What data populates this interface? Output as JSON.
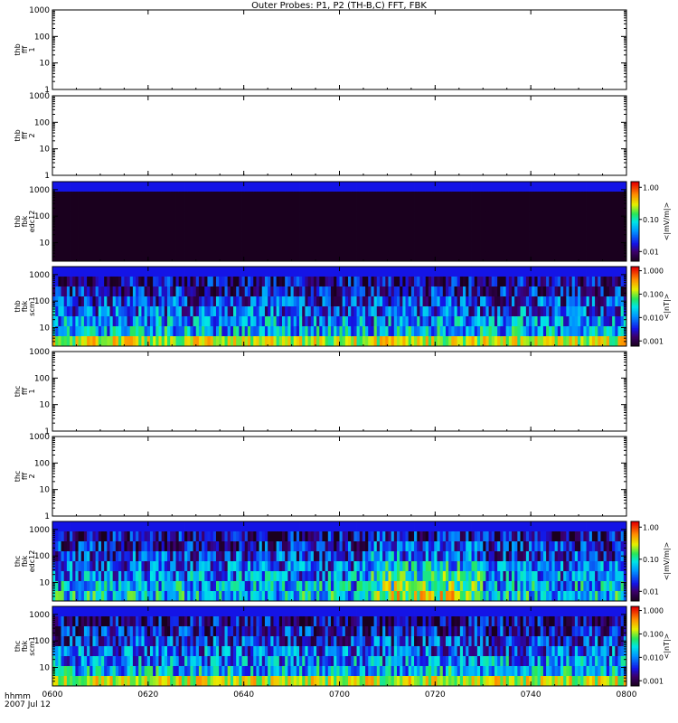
{
  "chart_data": {
    "type": "heatmap",
    "title": "Outer Probes: P1, P2 (TH-B,C) FFT, FBK",
    "x_ticks": [
      "0600",
      "0620",
      "0640",
      "0700",
      "0720",
      "0740",
      "0800"
    ],
    "x_range": [
      "0600",
      "0800"
    ],
    "x_label_lines": [
      "hhmm",
      "2007 Jul 12"
    ],
    "y_scale": "log",
    "panels": [
      {
        "name": "thb-fff-1",
        "ylabel": [
          "thb",
          "fff",
          "1"
        ],
        "y_range": [
          1,
          1000
        ],
        "y_ticks": [
          "1",
          "10",
          "100",
          "1000"
        ],
        "spectrogram": false
      },
      {
        "name": "thb-fff-2",
        "ylabel": [
          "thb",
          "fff",
          "2"
        ],
        "y_range": [
          1,
          1000
        ],
        "y_ticks": [
          "1",
          "10",
          "100",
          "1000"
        ],
        "spectrogram": false
      },
      {
        "name": "thb-fbk-edc12",
        "ylabel": [
          "thb",
          "fbk",
          "edc12"
        ],
        "y_range": [
          2,
          2000
        ],
        "y_ticks": [
          "10",
          "100",
          "1000"
        ],
        "spectrogram": true,
        "colorbar": {
          "label": "<|mV/m|>",
          "ticks": [
            "0.01",
            "0.10",
            "1.00"
          ],
          "range": [
            0.005,
            1.5
          ],
          "scale": "log"
        }
      },
      {
        "name": "thb-fbk-scm1",
        "ylabel": [
          "thb",
          "fbk",
          "scm1"
        ],
        "y_range": [
          2,
          2000
        ],
        "y_ticks": [
          "10",
          "100",
          "1000"
        ],
        "spectrogram": true,
        "colorbar": {
          "label": "<|nT|>",
          "ticks": [
            "0.001",
            "0.010",
            "0.100",
            "1.000"
          ],
          "range": [
            0.0006,
            1.5
          ],
          "scale": "log"
        }
      },
      {
        "name": "thc-fff-1",
        "ylabel": [
          "thc",
          "fff",
          "1"
        ],
        "y_range": [
          1,
          1000
        ],
        "y_ticks": [
          "1",
          "10",
          "100",
          "1000"
        ],
        "spectrogram": false
      },
      {
        "name": "thc-fff-2",
        "ylabel": [
          "thc",
          "fff",
          "2"
        ],
        "y_range": [
          1,
          1000
        ],
        "y_ticks": [
          "1",
          "10",
          "100",
          "1000"
        ],
        "spectrogram": false
      },
      {
        "name": "thc-fbk-edc12",
        "ylabel": [
          "thc",
          "fbk",
          "edc12"
        ],
        "y_range": [
          2,
          2000
        ],
        "y_ticks": [
          "10",
          "100",
          "1000"
        ],
        "spectrogram": true,
        "colorbar": {
          "label": "<|mV/m|>",
          "ticks": [
            "0.01",
            "0.10",
            "1.00"
          ],
          "range": [
            0.005,
            1.5
          ],
          "scale": "log"
        }
      },
      {
        "name": "thc-fbk-scm1",
        "ylabel": [
          "thc",
          "fbk",
          "scm1"
        ],
        "y_range": [
          2,
          2000
        ],
        "y_ticks": [
          "10",
          "100",
          "1000"
        ],
        "spectrogram": true,
        "colorbar": {
          "label": "<|nT|>",
          "ticks": [
            "0.001",
            "0.010",
            "0.100",
            "1.000"
          ],
          "range": [
            0.0006,
            1.5
          ],
          "scale": "log"
        }
      }
    ]
  }
}
